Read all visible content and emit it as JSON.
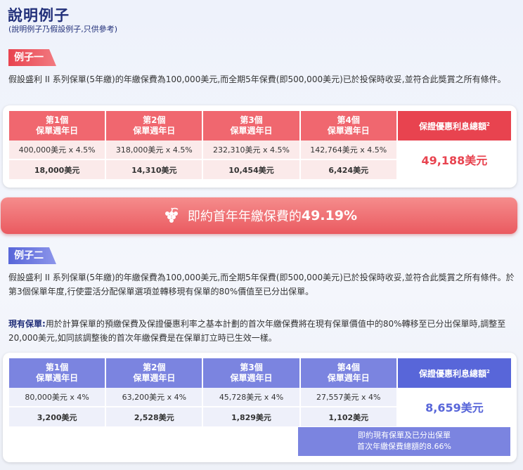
{
  "title": "說明例子",
  "subtitle": "(說明例子乃假設例子,只供參考)",
  "ex1": {
    "tag": "例子一",
    "text": "假設盛利 II 系列保單(5年繳)的年繳保費為100,000美元,而全期5年保費(即500,000美元)已於投保時收妥,並符合此獎賞之所有條件。",
    "headers": [
      [
        "第1個",
        "保單週年日"
      ],
      [
        "第2個",
        "保單週年日"
      ],
      [
        "第3個",
        "保單週年日"
      ],
      [
        "第4個",
        "保單週年日"
      ]
    ],
    "total_header": "保證優惠利息總額",
    "sup": "2",
    "calc": [
      "400,000美元 x 4.5%",
      "318,000美元 x 4.5%",
      "232,310美元 x 4.5%",
      "142,764美元 x 4.5%"
    ],
    "amounts": [
      "18,000美元",
      "14,310美元",
      "10,454美元",
      "6,424美元"
    ],
    "total": "49,188美元"
  },
  "banner": {
    "text": "即約首年年繳保費的",
    "value": "49.19%"
  },
  "ex2": {
    "tag": "例子二",
    "text": "假設盛利 II 系列保單(5年繳)的年繳保費為100,000美元,而全期5年保費(即500,000美元)已於投保時收妥,並符合此獎賞之所有條件。於第3個保單年度,行使靈活分配保單選項並轉移現有保單的80%價值至已分出保單。",
    "label": "現有保單:",
    "note_text": "用於計算保單的預繳保費及保證優惠利率之基本計劃的首次年繳保費將在現有保單價值中的80%轉移至已分出保單時,調整至20,000美元,如同該調整後的首次年繳保費是在保單訂立時已生效一樣。",
    "headers": [
      [
        "第1個",
        "保單週年日"
      ],
      [
        "第2個",
        "保單週年日"
      ],
      [
        "第3個",
        "保單週年日"
      ],
      [
        "第4個",
        "保單週年日"
      ]
    ],
    "total_header": "保證優惠利息總額",
    "sup": "2",
    "calc": [
      "80,000美元 x 4%",
      "63,200美元 x 4%",
      "45,728美元 x 4%",
      "27,557美元 x 4%"
    ],
    "amounts": [
      "3,200美元",
      "2,528美元",
      "1,829美元",
      "1,102美元"
    ],
    "total": "8,659美元",
    "footnote_line1": "即約現有保單及已分出保單",
    "footnote_line2": "首次年繳保費總額的8.66%"
  }
}
